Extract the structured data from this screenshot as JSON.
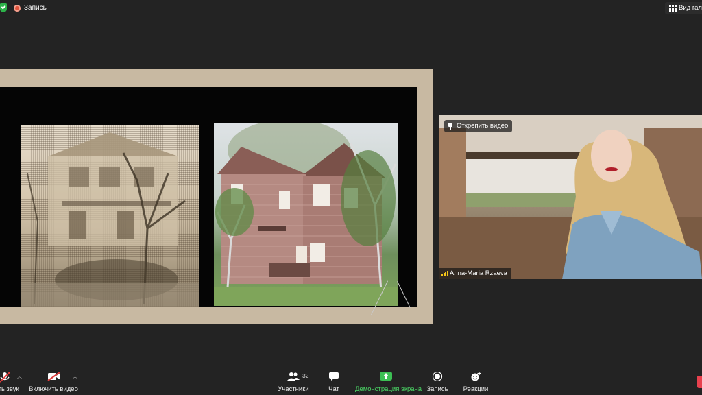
{
  "top_bar": {
    "recording_label": "Запись",
    "gallery_view_label": "Вид галереи"
  },
  "video": {
    "unpin_label": "Открепить видео",
    "participant_name": "Anna-Maria Rzaeva"
  },
  "toolbar": {
    "mute_label": "ить звук",
    "video_label": "Включить видео",
    "participants_label": "Участники",
    "participants_count": "32",
    "chat_label": "Чат",
    "share_label": "Демонстрация экрана",
    "record_label": "Запись",
    "reactions_label": "Реакции"
  },
  "colors": {
    "background": "#232323",
    "slide_frame": "#c8b9a2",
    "share_accent": "#3cc054",
    "recording": "#e0533c",
    "signal": "#f5c518"
  }
}
